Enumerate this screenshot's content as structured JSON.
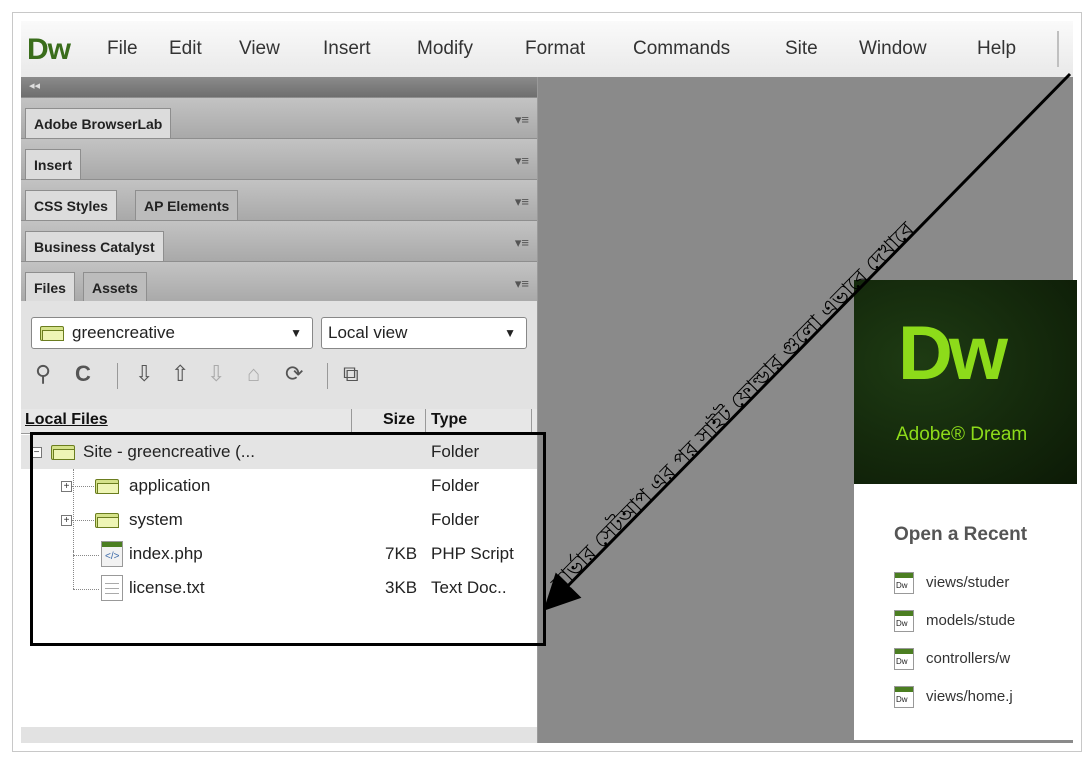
{
  "menubar": {
    "logo": "Dw",
    "items": [
      "File",
      "Edit",
      "View",
      "Insert",
      "Modify",
      "Format",
      "Commands",
      "Site",
      "Window",
      "Help"
    ]
  },
  "panels": {
    "browserlab": {
      "tab": "Adobe BrowserLab"
    },
    "insert": {
      "tab": "Insert"
    },
    "css": {
      "tab1": "CSS Styles",
      "tab2": "AP Elements"
    },
    "business": {
      "tab": "Business Catalyst"
    },
    "files": {
      "tab1": "Files",
      "tab2": "Assets"
    }
  },
  "files_panel": {
    "site_select": "greencreative",
    "view_select": "Local view",
    "columns": {
      "name": "Local Files",
      "size": "Size",
      "type": "Type"
    },
    "rows": [
      {
        "name": "Site - greencreative (...",
        "size": "",
        "type": "Folder"
      },
      {
        "name": "application",
        "size": "",
        "type": "Folder"
      },
      {
        "name": "system",
        "size": "",
        "type": "Folder"
      },
      {
        "name": "index.php",
        "size": "7KB",
        "type": "PHP Script"
      },
      {
        "name": "license.txt",
        "size": "3KB",
        "type": "Text Doc.."
      }
    ]
  },
  "welcome": {
    "logo": "Dw",
    "product": "Adobe® Dream",
    "recent_title": "Open a Recent",
    "recent_items": [
      "views/studer",
      "models/stude",
      "controllers/w",
      "views/home.j"
    ],
    "icon_label": "Dw"
  },
  "annotation": {
    "text": "সার্ভার সেটআপ এর পর সাইট ফোল্ডার গুলো এভাবে দেখাবে"
  },
  "colors": {
    "dw_green": "#8ddb1a",
    "logo_green": "#3a6d1b",
    "document_gray": "#8a8a8a"
  }
}
